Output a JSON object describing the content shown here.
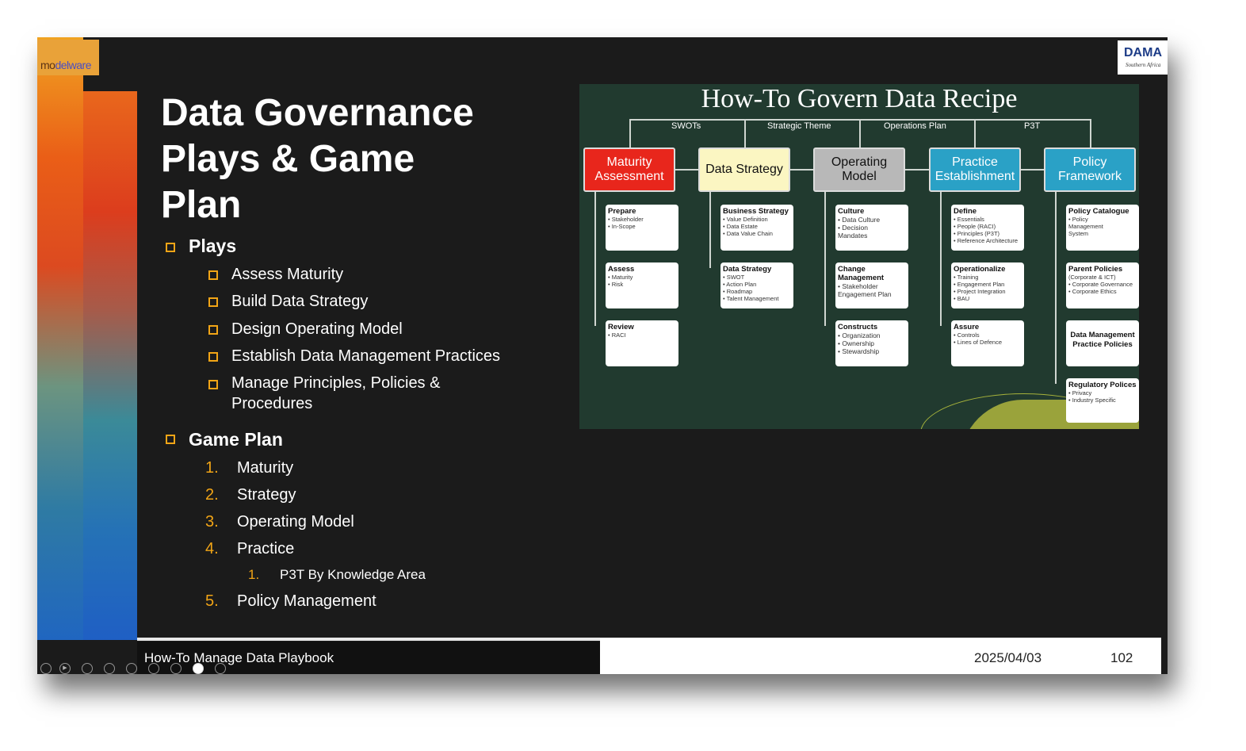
{
  "slide": {
    "title_lines": [
      "Data Governance",
      "Plays & Game",
      "Plan"
    ],
    "logo_left": {
      "pre": "m",
      "mid": "o",
      "post": "delware"
    },
    "logo_right": {
      "big": "DAMA",
      "small": "Southern Africa"
    },
    "plays": {
      "heading": "Plays",
      "items": [
        "Assess Maturity",
        "Build Data Strategy",
        "Design Operating Model",
        "Establish Data Management Practices",
        "Manage Principles, Policies &",
        "Procedures"
      ]
    },
    "game_plan": {
      "heading": "Game Plan",
      "items": [
        {
          "num": "1.",
          "label": "Maturity"
        },
        {
          "num": "2.",
          "label": "Strategy"
        },
        {
          "num": "3.",
          "label": "Operating Model"
        },
        {
          "num": "4.",
          "label": "Practice"
        },
        {
          "num": "1.",
          "label": "P3T By Knowledge Area"
        },
        {
          "num": "5.",
          "label": "Policy Management"
        }
      ]
    }
  },
  "diagram": {
    "title": "How-To Govern Data Recipe",
    "connector_labels": [
      "SWOTs",
      "Strategic Theme",
      "Operations Plan",
      "P3T"
    ],
    "categories": [
      {
        "label": "Maturity Assessment",
        "bg": "#e8261c",
        "fg": "#ffffff"
      },
      {
        "label": "Data Strategy",
        "bg": "#fbf6c2",
        "fg": "#111111"
      },
      {
        "label": "Operating Model",
        "bg": "#b8b8b8",
        "fg": "#111111"
      },
      {
        "label": "Practice Establishment",
        "bg": "#2aa1c6",
        "fg": "#ffffff"
      },
      {
        "label": "Policy Framework",
        "bg": "#2aa1c6",
        "fg": "#ffffff"
      }
    ],
    "columns": [
      [
        {
          "h": "Prepare",
          "items": [
            "• Stakeholder",
            "• In-Scope"
          ]
        },
        {
          "h": "Assess",
          "items": [
            "• Maturity",
            "• Risk"
          ]
        },
        {
          "h": "Review",
          "items": [
            "• RACI"
          ]
        }
      ],
      [
        {
          "h": "Business Strategy",
          "items": [
            "• Value Definition",
            "• Data Estate",
            "• Data Value Chain"
          ]
        },
        {
          "h": "Data Strategy",
          "items": [
            "• SWOT",
            "• Action Plan",
            "• Roadmap",
            "• Talent Management"
          ]
        }
      ],
      [
        {
          "h": "Culture",
          "items": [
            "• Data Culture",
            "• Decision",
            "Mandates"
          ]
        },
        {
          "h": "Change Management",
          "items": [
            "• Stakeholder",
            "Engagement Plan"
          ]
        },
        {
          "h": "Constructs",
          "items": [
            "• Organization",
            "• Ownership",
            "• Stewardship"
          ]
        }
      ],
      [
        {
          "h": "Define",
          "items": [
            "• Essentials",
            "• People (RACI)",
            "• Principles (P3T)",
            "• Reference Architecture"
          ]
        },
        {
          "h": "Operationalize",
          "items": [
            "• Training",
            "• Engagement Plan",
            "• Project Integration",
            "• BAU"
          ]
        },
        {
          "h": "Assure",
          "items": [
            "• Controls",
            "• Lines of Defence"
          ]
        }
      ],
      [
        {
          "h": "Policy Catalogue",
          "items": [
            "• Policy",
            "Management",
            "System"
          ]
        },
        {
          "h": "Parent Policies",
          "items": [
            "(Corporate & ICT)",
            "• Corporate Governance",
            "• Corporate Ethics"
          ]
        },
        {
          "h": "Data Management Practice Policies",
          "items": []
        },
        {
          "h": "Regulatory Polices",
          "items": [
            "• Privacy",
            "• Industry Specific"
          ]
        }
      ]
    ]
  },
  "footer": {
    "title": "How-To Manage Data Playbook",
    "date": "2025/04/03",
    "page": "102"
  }
}
